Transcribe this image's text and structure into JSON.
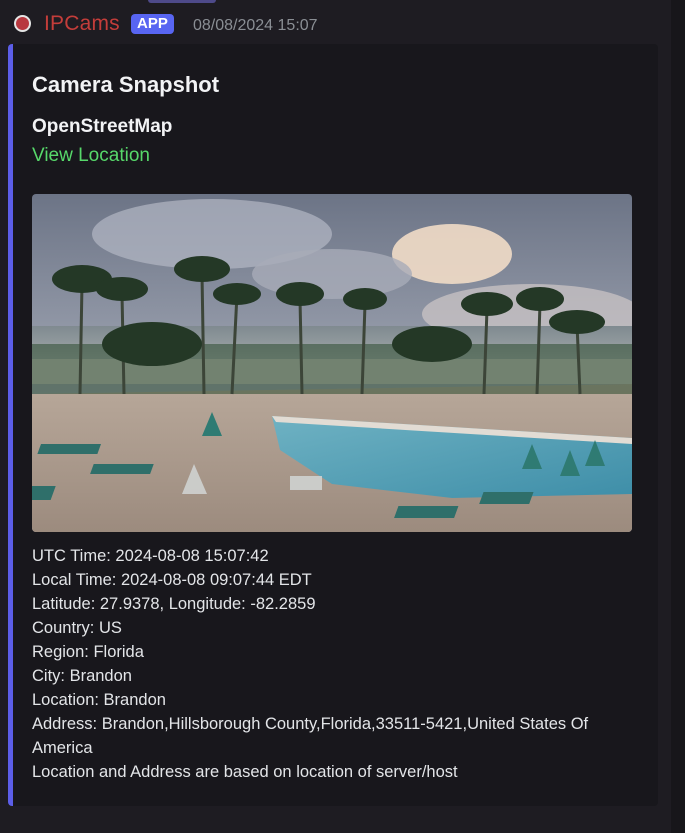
{
  "message": {
    "username": "IPCams",
    "badge": "APP",
    "timestamp": "08/08/2024 15:07"
  },
  "embed": {
    "title": "Camera Snapshot",
    "field_name": "OpenStreetMap",
    "link_text": "View Location",
    "accent_color": "#5c5ee8"
  },
  "details": [
    "UTC Time: 2024-08-08 15:07:42",
    "Local Time: 2024-08-08 09:07:44 EDT",
    "Latitude: 27.9378, Longitude: -82.2859",
    "Country: US",
    "Region: Florida",
    "City: Brandon",
    "Location: Brandon",
    "Address: Brandon,Hillsborough County,Florida,33511-5421,United States Of America",
    "Location and Address are based on location of server/host"
  ],
  "colors": {
    "username": "#c43d3a",
    "badge": "#5865f2",
    "link": "#57d86a"
  }
}
